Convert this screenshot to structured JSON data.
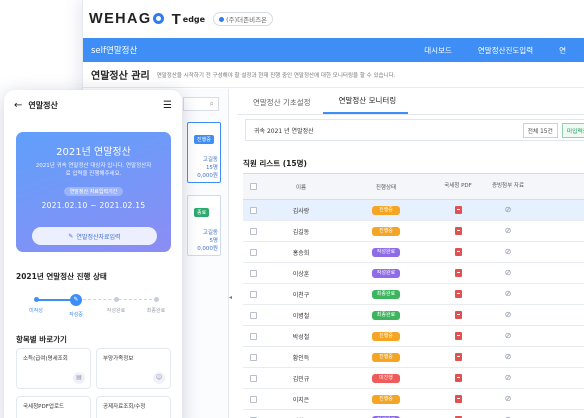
{
  "brand": {
    "logo": "WEHAG",
    "tedge": "T",
    "tedge_word": "edge",
    "company": "(주)더존비즈온",
    "accent": "#3f8ef5"
  },
  "header": {
    "app_title": "self연말정산",
    "nav": [
      "대시보드",
      "연말정산진도입력",
      "연"
    ]
  },
  "page": {
    "title": "연말정산 관리",
    "desc": "연말정산을 시작하기 전 구성해야 할 설정과 현재 진행 중인 연말정산에 대한 모니터링을 할 수 있습니다."
  },
  "left_panel": {
    "search_icon": "search-icon",
    "cards": [
      {
        "badge": "진행중",
        "lines": [
          "고길동",
          "15명",
          "0,000원"
        ]
      },
      {
        "badge": "종료",
        "lines": [
          "고길동",
          "5명",
          "0,000원"
        ]
      }
    ]
  },
  "tabs": [
    "연말정산 기초설정",
    "연말정산 모니터링"
  ],
  "filter": {
    "label": "귀속 2021 년 연말정산",
    "chips": [
      "전체  15건",
      "미입력중  2건"
    ]
  },
  "table": {
    "title": "직원 리스트 (15명)",
    "headers": [
      "이름",
      "진행상태",
      "국세청 PDF",
      "증빙첨부 자료"
    ],
    "rows": [
      {
        "name": "김사랑",
        "status": "진행중",
        "color": "#f5a524"
      },
      {
        "name": "김길동",
        "status": "진행중",
        "color": "#f5a524"
      },
      {
        "name": "홍승희",
        "status": "작성완료",
        "color": "#8e6be8"
      },
      {
        "name": "이상훈",
        "status": "작성완료",
        "color": "#8e6be8"
      },
      {
        "name": "이천구",
        "status": "최종완료",
        "color": "#3cb55e"
      },
      {
        "name": "이병철",
        "status": "최종완료",
        "color": "#3cb55e"
      },
      {
        "name": "박성철",
        "status": "진행중",
        "color": "#f5a524"
      },
      {
        "name": "황인득",
        "status": "진행중",
        "color": "#f5a524"
      },
      {
        "name": "김민규",
        "status": "미진행",
        "color": "#ef5a5a"
      },
      {
        "name": "이지은",
        "status": "진행중",
        "color": "#f5a524"
      },
      {
        "name": "이천구",
        "status": "작성완료",
        "color": "#8e6be8"
      }
    ]
  },
  "mobile": {
    "title": "연말정산",
    "card": {
      "title": "2021년 연말정산",
      "desc": "2021년 귀속 연말정산 대상자 입니다. 연말정산자료 입력을 진행해주세요.",
      "badge": "연말정산 자료입력기간",
      "period": "2021.02.10 ~ 2021.02.15",
      "button": "연말정산자료입력"
    },
    "status_title": "2021년 연말정산 진행 상태",
    "steps": [
      "미작성",
      "작성중",
      "작성완료",
      "최종완료"
    ],
    "shortcut_title": "항목별 바로가기",
    "tiles": [
      {
        "label": "소득(급여)명세조회",
        "icon": "document-icon"
      },
      {
        "label": "부양가족정보",
        "icon": "people-icon"
      },
      {
        "label": "국세청PDF업로드",
        "icon": "upload-icon"
      },
      {
        "label": "공제자료조회/수정",
        "icon": "edit-icon"
      }
    ]
  }
}
